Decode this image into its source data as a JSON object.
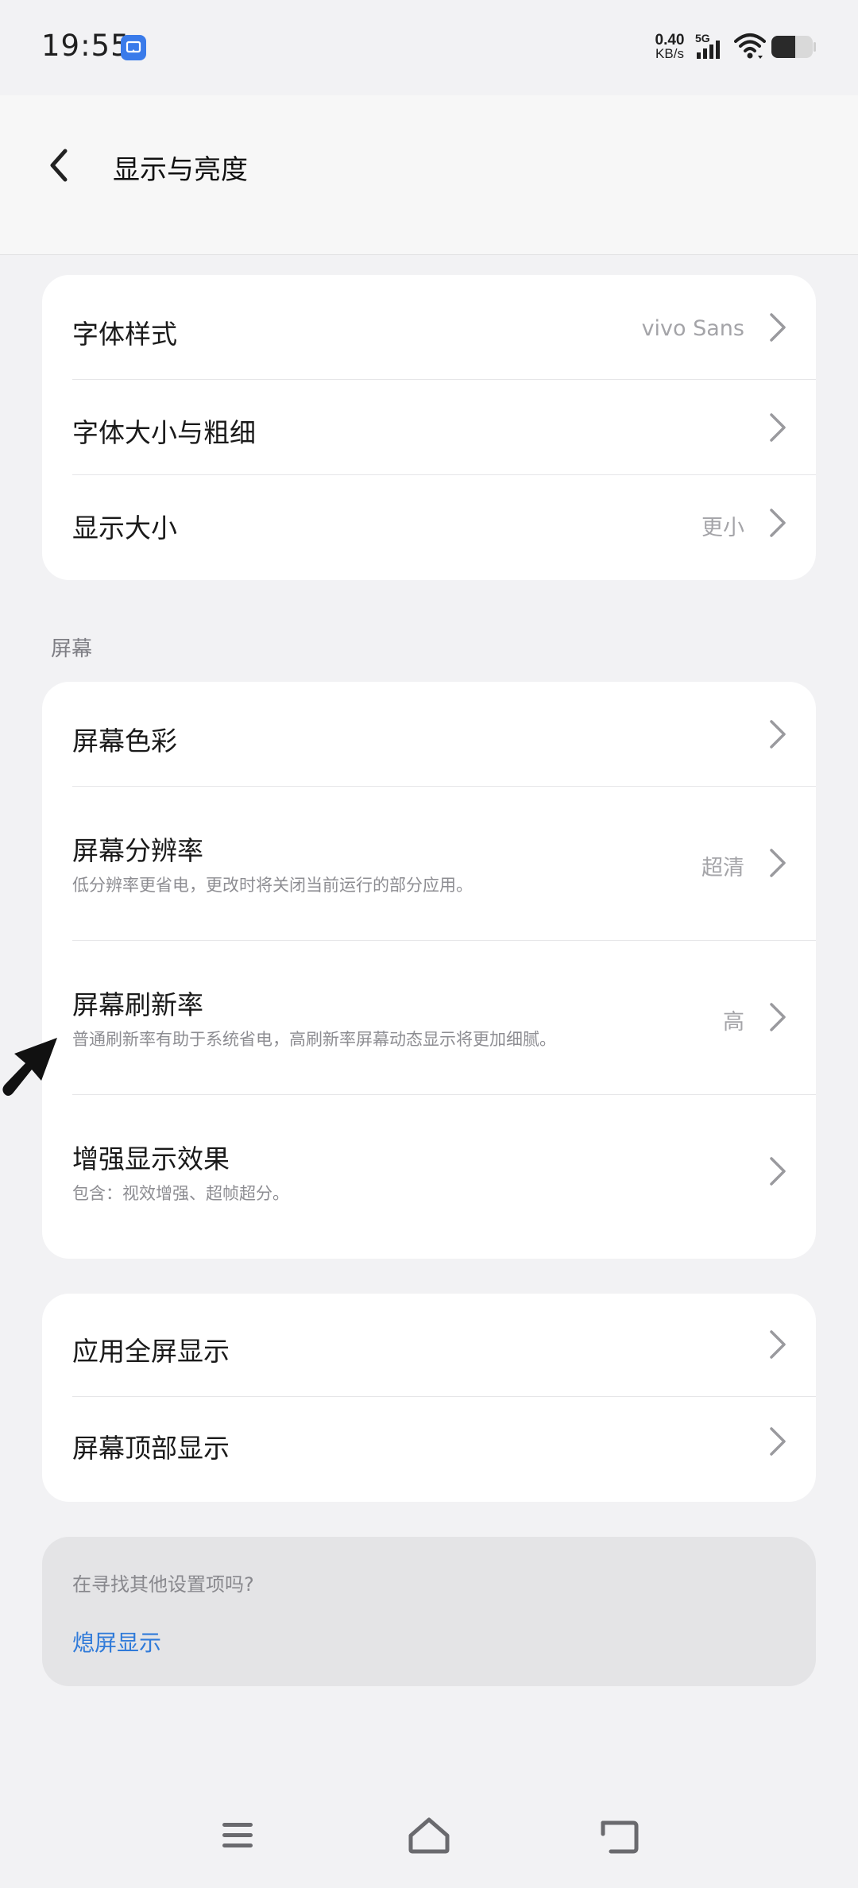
{
  "status_bar": {
    "time": "19:55",
    "net_speed_value": "0.40",
    "net_speed_unit": "KB/s",
    "network": "5G"
  },
  "header": {
    "title": "显示与亮度"
  },
  "card1": [
    {
      "label": "字体样式",
      "value": "vivo Sans"
    },
    {
      "label": "字体大小与粗细",
      "value": ""
    },
    {
      "label": "显示大小",
      "value": "更小"
    }
  ],
  "section_screen": {
    "label": "屏幕",
    "items": [
      {
        "label": "屏幕色彩",
        "sub": "",
        "value": ""
      },
      {
        "label": "屏幕分辨率",
        "sub": "低分辨率更省电，更改时将关闭当前运行的部分应用。",
        "value": "超清"
      },
      {
        "label": "屏幕刷新率",
        "sub": "普通刷新率有助于系统省电，高刷新率屏幕动态显示将更加细腻。",
        "value": "高"
      },
      {
        "label": "增强显示效果",
        "sub": "包含：视效增强、超帧超分。",
        "value": ""
      }
    ]
  },
  "card3": [
    {
      "label": "应用全屏显示"
    },
    {
      "label": "屏幕顶部显示"
    }
  ],
  "hint": {
    "question": "在寻找其他设置项吗?",
    "link": "熄屏显示"
  },
  "colors": {
    "accent_link": "#2f7ad9",
    "background": "#f2f2f4",
    "card": "#ffffff"
  },
  "icons": {
    "back": "chevron-left-icon",
    "row_arrow": "chevron-right-icon",
    "nav_menu": "menu-icon",
    "nav_home": "home-icon",
    "nav_back": "back-icon"
  }
}
